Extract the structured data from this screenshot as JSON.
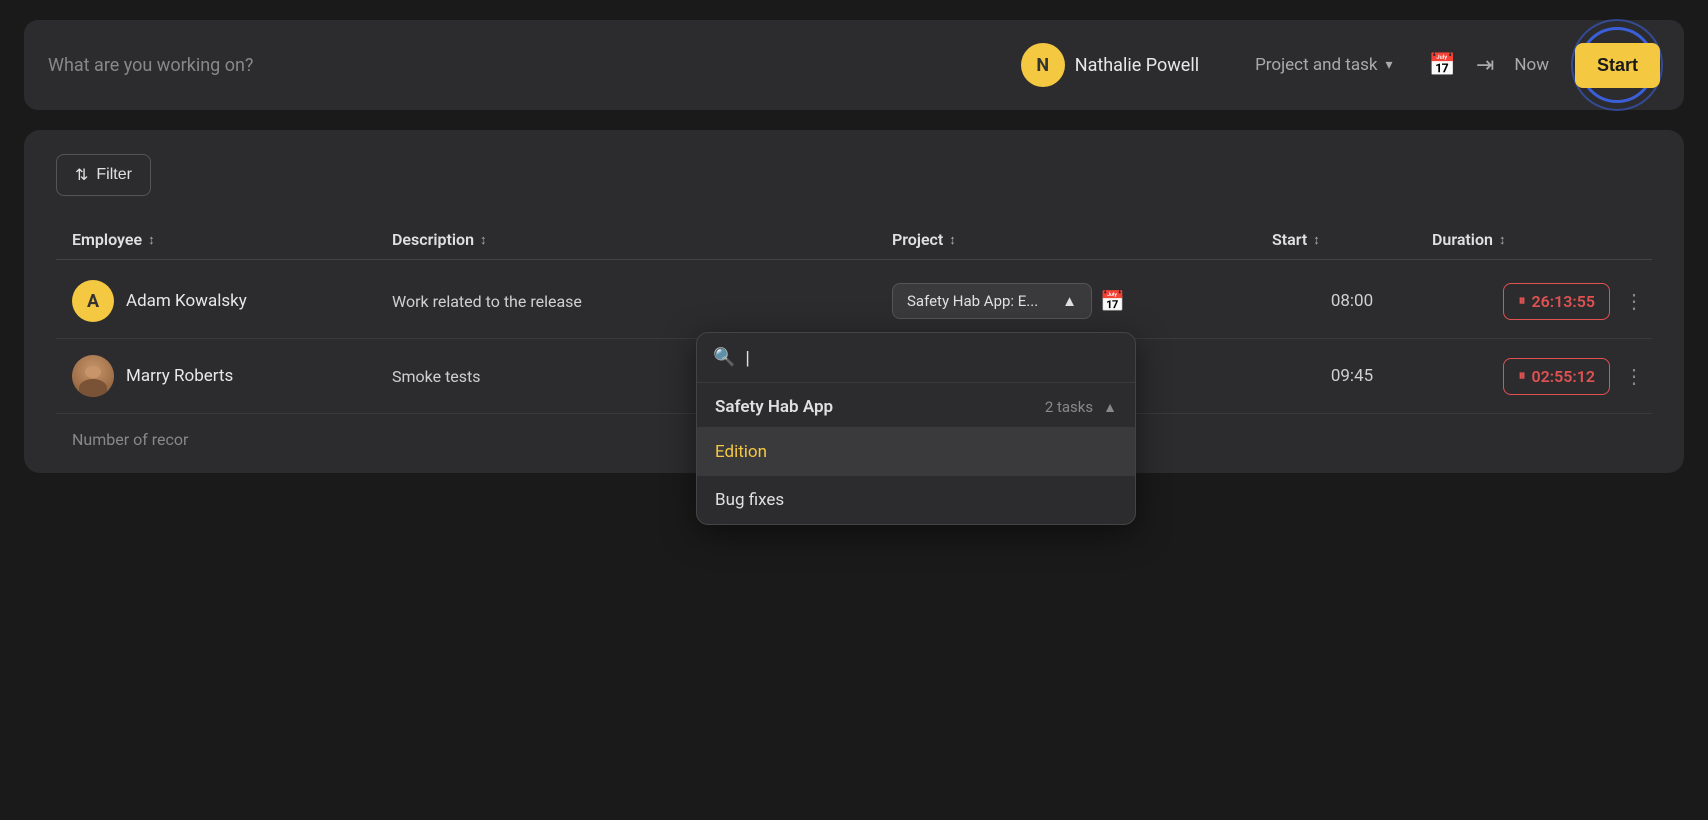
{
  "topbar": {
    "search_placeholder": "What are you working on?",
    "user_initial": "N",
    "user_name": "Nathalie Powell",
    "project_task_label": "Project and task",
    "now_label": "Now",
    "start_label": "Start"
  },
  "filter": {
    "label": "Filter"
  },
  "table": {
    "columns": [
      {
        "key": "employee",
        "label": "Employee"
      },
      {
        "key": "description",
        "label": "Description"
      },
      {
        "key": "project",
        "label": "Project"
      },
      {
        "key": "start",
        "label": "Start"
      },
      {
        "key": "duration",
        "label": "Duration"
      }
    ],
    "rows": [
      {
        "employee_initial": "A",
        "employee_name": "Adam Kowalsky",
        "description": "Work related to the release",
        "project": "Safety Hab App: E...",
        "start_time": "08:00",
        "duration": "26:13:55"
      },
      {
        "employee_name": "Marry Roberts",
        "description": "Smoke tests",
        "project": "",
        "start_time": "09:45",
        "duration": "02:55:12"
      }
    ],
    "records_prefix": "Number of recor"
  },
  "dropdown": {
    "search_placeholder": "|",
    "group_name": "Safety Hab App",
    "group_count": "2 tasks",
    "items": [
      {
        "label": "Edition",
        "highlighted": true
      },
      {
        "label": "Bug fixes",
        "highlighted": false
      }
    ]
  }
}
